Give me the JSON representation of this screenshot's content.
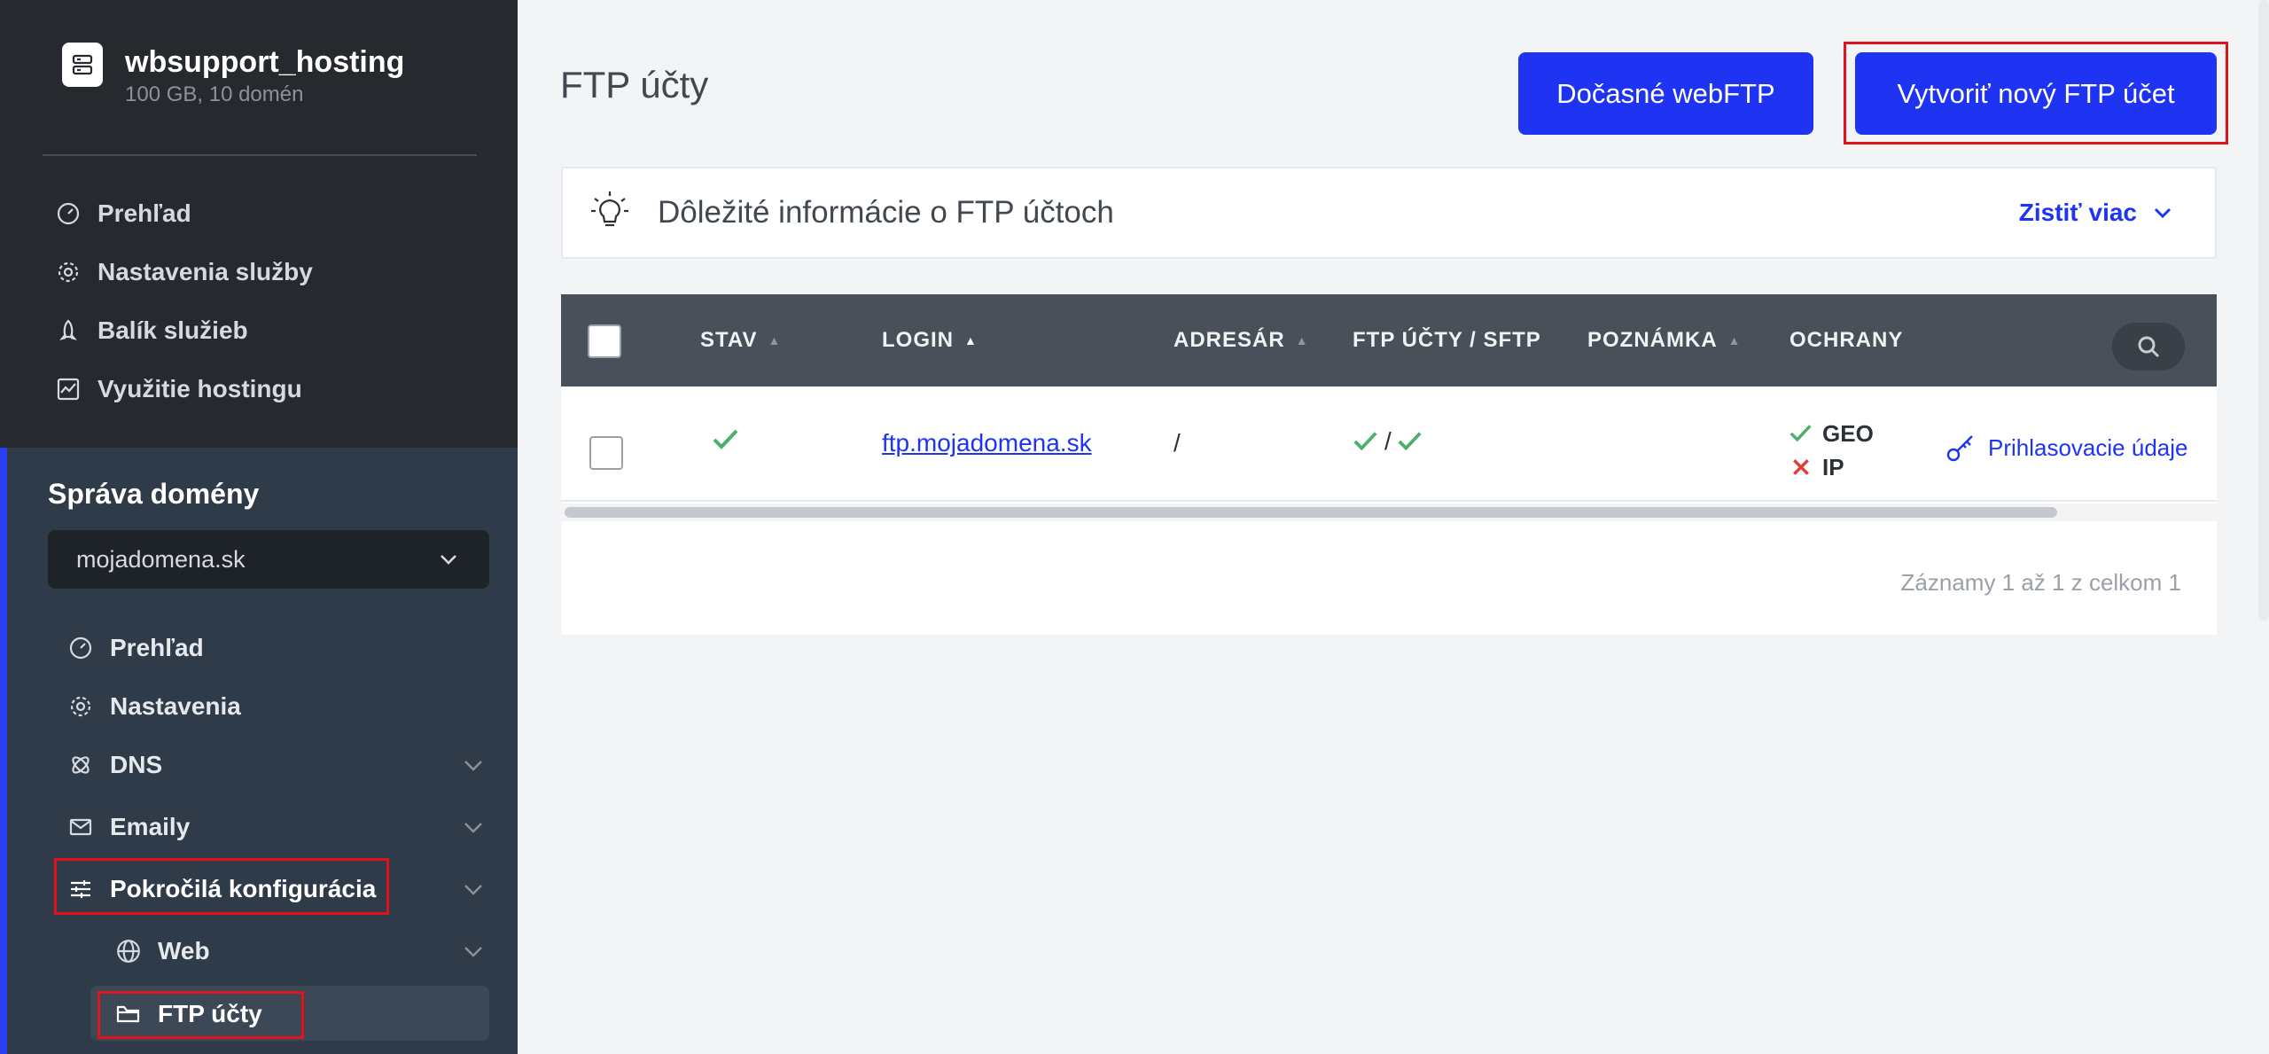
{
  "account": {
    "name": "wbsupport_hosting",
    "subtitle": "100 GB, 10 domén"
  },
  "service_nav": [
    {
      "label": "Prehľad",
      "icon": "gauge-icon"
    },
    {
      "label": "Nastavenia služby",
      "icon": "gear-icon"
    },
    {
      "label": "Balík služieb",
      "icon": "rocket-icon"
    },
    {
      "label": "Využitie hostingu",
      "icon": "chart-icon"
    }
  ],
  "domain_section": {
    "title": "Správa domény",
    "selected_domain": "mojadomena.sk"
  },
  "domain_nav": [
    {
      "label": "Prehľad",
      "icon": "gauge-icon"
    },
    {
      "label": "Nastavenia",
      "icon": "gear-icon"
    },
    {
      "label": "DNS",
      "icon": "dns-icon"
    },
    {
      "label": "Emaily",
      "icon": "mail-icon"
    },
    {
      "label": "Pokročilá konfigurácia",
      "icon": "sliders-icon"
    },
    {
      "label": "Web",
      "icon": "globe-icon"
    },
    {
      "label": "FTP účty",
      "icon": "folder-icon"
    }
  ],
  "page": {
    "title": "FTP účty",
    "btn_webftp": "Dočasné webFTP",
    "btn_create": "Vytvoriť nový FTP účet"
  },
  "info": {
    "text": "Dôležité informácie o FTP účtoch",
    "link": "Zistiť viac"
  },
  "table": {
    "columns": [
      "STAV",
      "LOGIN",
      "ADRESÁR",
      "FTP ÚČTY / SFTP",
      "POZNÁMKA",
      "OCHRANY"
    ],
    "rows": [
      {
        "login": "ftp.mojadomena.sk",
        "directory": "/",
        "ftp_sftp_sep": "/",
        "note": "",
        "protections": [
          {
            "label": "GEO",
            "status": "ok"
          },
          {
            "label": "IP",
            "status": "off"
          }
        ],
        "credentials_link": "Prihlasovacie údaje"
      }
    ],
    "footer": "Záznamy 1 až 1 z celkom 1"
  },
  "colors": {
    "accent": "#1e34f2",
    "highlight": "#e0131b",
    "success": "#4caf6e",
    "danger": "#e53935"
  }
}
